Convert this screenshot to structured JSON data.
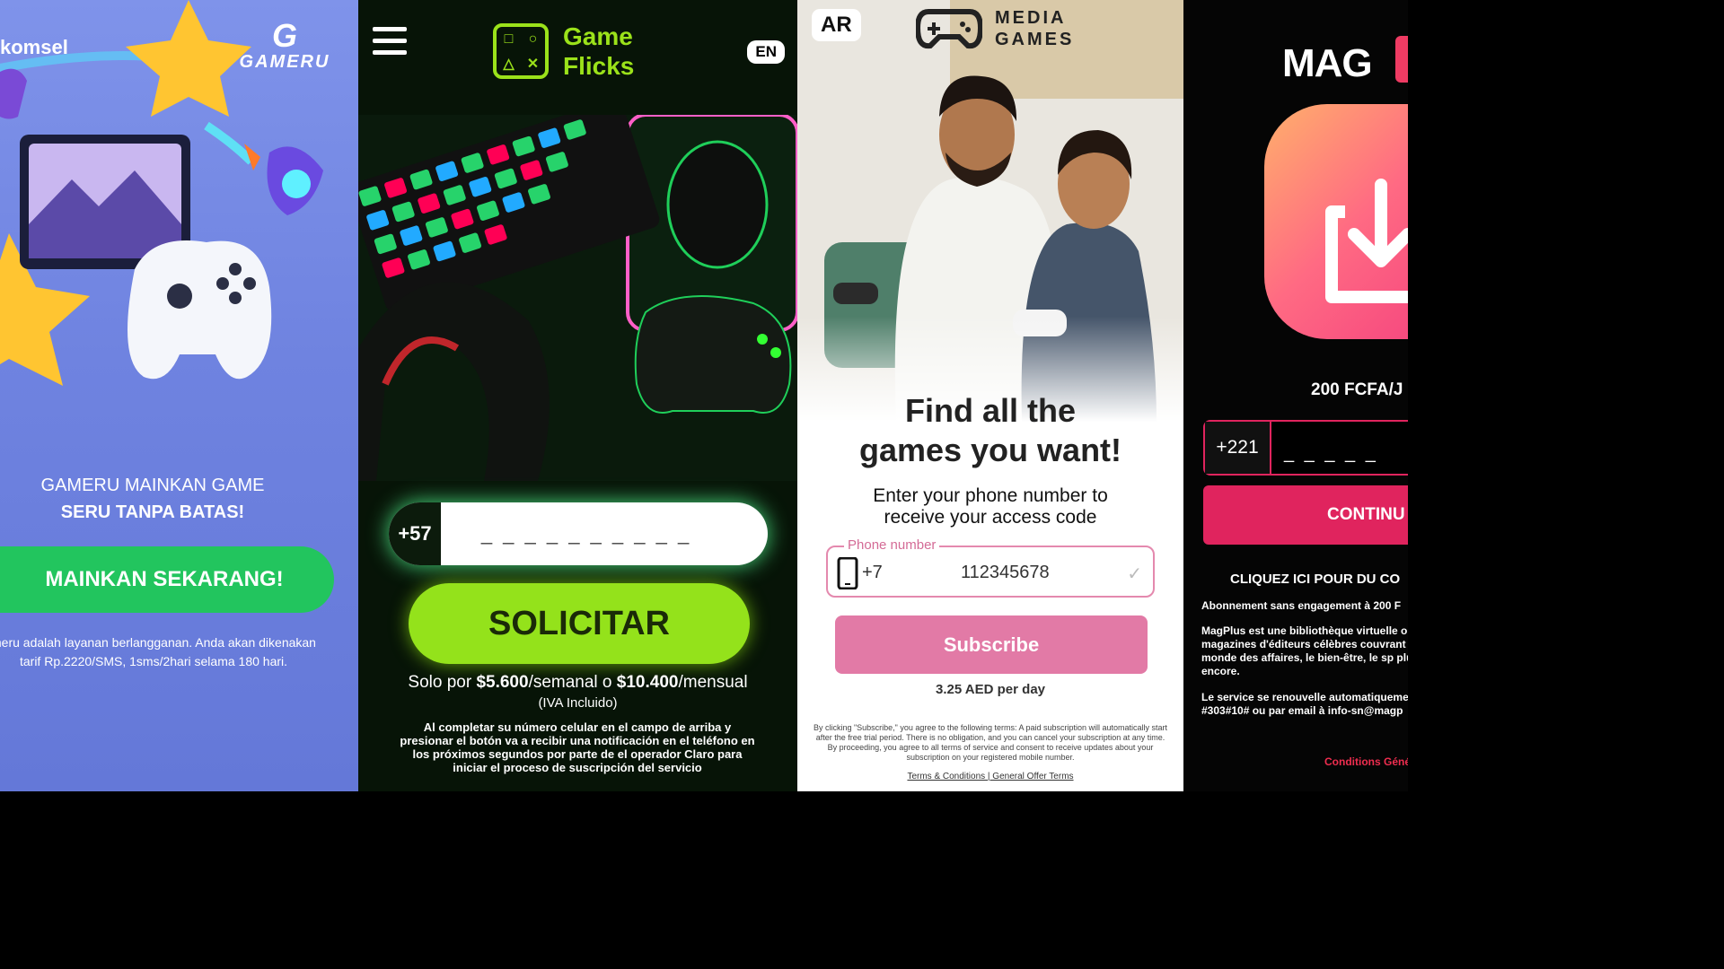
{
  "gameru": {
    "operator": "komsel",
    "logo_text": "GAMERU",
    "headline_line1": "GAMERU MAINKAN GAME",
    "headline_line2": "SERU TANPA BATAS!",
    "cta_label": "MAINKAN SEKARANG!",
    "legal": "meru adalah layanan berlangganan. Anda akan dikenakan tarif Rp.2220/SMS, 1sms/2hari selama 180 hari."
  },
  "gameflicks": {
    "logo_text": "Game Flicks",
    "lang": "EN",
    "phone_prefix": "+57",
    "phone_mask": "_ _ _ _ _ _ _ _ _ _",
    "cta_label": "SOLICITAR",
    "price_lead": "Solo por ",
    "price_week": "$5.600",
    "price_week_unit": "/semanal o ",
    "price_month": "$10.400",
    "price_month_unit": "/mensual",
    "iva": "(IVA Incluido)",
    "legal": "Al completar su número celular en el campo de arriba y presionar el botón va a recibir una notificación en el teléfono en los próximos segundos por parte de el operador Claro para iniciar el proceso de suscripción del servicio"
  },
  "mediagames": {
    "lang": "AR",
    "logo_line1": "MEDIA",
    "logo_line2": "GAMES",
    "headline": "Find all the games you want!",
    "subtext": "Enter your phone number to receive your access code",
    "field_label": "Phone number",
    "country_code": "+7",
    "phone_value": "112345678",
    "cta_label": "Subscribe",
    "price": "3.25 AED per day",
    "legal": "By clicking \"Subscribe,\" you agree to the following terms: A paid subscription will automatically start after the free trial period. There is no obligation, and you can cancel your subscription at any time. By proceeding, you agree to all terms of service and consent to receive updates about your subscription on your registered mobile number.",
    "links": "Terms & Conditions | General Offer Terms"
  },
  "magplus": {
    "logo_text": "MAG",
    "price": "200 FCFA/J",
    "phone_prefix": "+221",
    "phone_mask": "_ _ _ _ _",
    "cta_label": "CONTINU",
    "click_here": "CLIQUEZ ICI POUR DU CO",
    "terms1": "Abonnement sans engagement à 200 F",
    "terms2": "MagPlus est une bibliothèque virtuelle o magazines d'éditeurs célèbres couvrant le monde des affaires, le bien-être, le sp plus encore.",
    "terms3": "Le service se renouvelle automatiqueme #303#10# ou par email à info-sn@magp",
    "conditions": "Conditions Géné"
  },
  "colors": {
    "gameru_bg": "#7083e0",
    "gameru_cta": "#22c55e",
    "gameflicks_accent": "#94e21b",
    "mediagames_accent": "#e27aa6",
    "magplus_accent": "#e0245e"
  }
}
